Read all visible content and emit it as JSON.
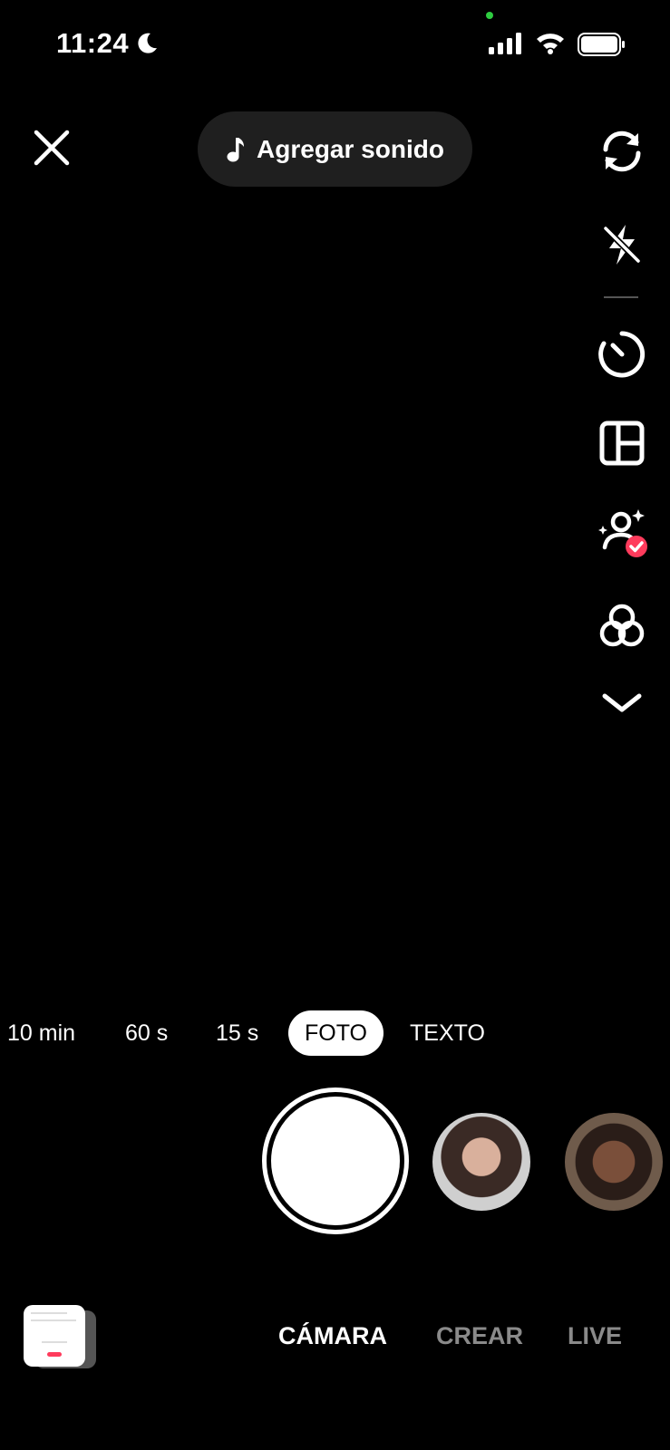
{
  "status_bar": {
    "time": "11:24",
    "icons": [
      "moon-icon",
      "camera-in-use-dot",
      "signal-icon",
      "wifi-icon",
      "battery-icon"
    ]
  },
  "top": {
    "close_icon": "close-icon",
    "sound_label": "Agregar sonido",
    "sound_icon": "music-note-icon"
  },
  "right_toolbar": {
    "items": [
      "flip-camera-icon",
      "flash-off-icon",
      "timer-icon",
      "layout-icon",
      "retouch-icon",
      "filters-icon",
      "chevron-down-icon"
    ]
  },
  "modes": {
    "items": [
      {
        "label": "10 min"
      },
      {
        "label": "60 s"
      },
      {
        "label": "15 s"
      },
      {
        "label": "FOTO"
      },
      {
        "label": "TEXTO"
      }
    ],
    "selected": "FOTO"
  },
  "bottom_tabs": {
    "camera": "CÁMARA",
    "create": "CREAR",
    "live": "LIVE",
    "selected": "CÁMARA"
  },
  "colors": {
    "background": "#000000",
    "accent": "#ff3b5c",
    "inactive_tab": "#8a8a8a"
  }
}
